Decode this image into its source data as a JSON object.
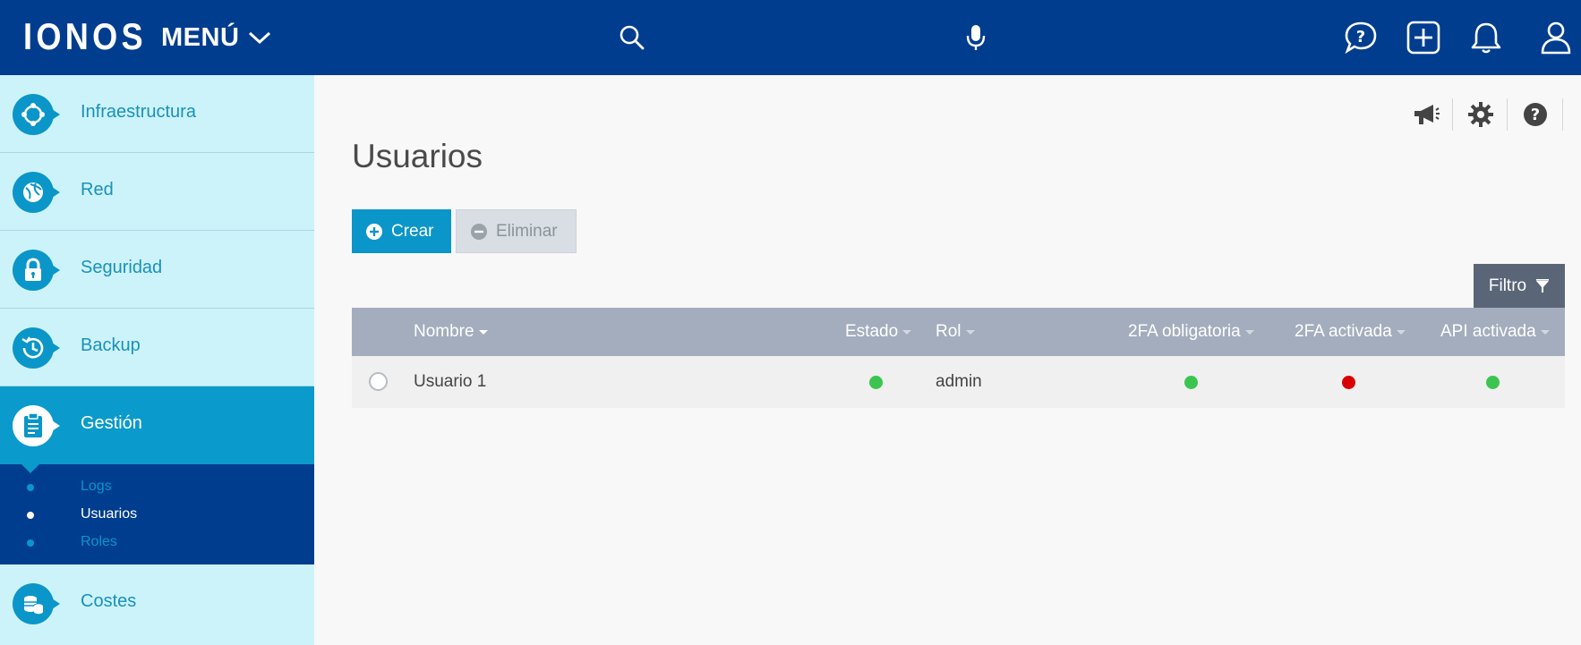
{
  "header": {
    "logo": "IONOS",
    "menu_label": "MENÚ",
    "icons": [
      "search-icon",
      "microphone-icon",
      "help-chat-icon",
      "add-icon",
      "bell-icon",
      "user-icon"
    ]
  },
  "sidebar": {
    "items": [
      {
        "label": "Infraestructura",
        "icon": "infrastructure-icon"
      },
      {
        "label": "Red",
        "icon": "network-globe-icon"
      },
      {
        "label": "Seguridad",
        "icon": "lock-icon"
      },
      {
        "label": "Backup",
        "icon": "backup-clock-icon"
      },
      {
        "label": "Gestión",
        "icon": "clipboard-icon"
      },
      {
        "label": "Costes",
        "icon": "coins-icon"
      }
    ],
    "submenu": [
      {
        "label": "Logs"
      },
      {
        "label": "Usuarios"
      },
      {
        "label": "Roles"
      }
    ]
  },
  "main": {
    "title": "Usuarios",
    "create_label": "Crear",
    "delete_label": "Eliminar",
    "filter_label": "Filtro",
    "utility_icons": [
      "megaphone-icon",
      "gear-icon",
      "question-icon"
    ],
    "table": {
      "columns": [
        "Nombre",
        "Estado",
        "Rol",
        "2FA obligatoria",
        "2FA activada",
        "API activada"
      ],
      "rows": [
        {
          "nombre": "Usuario 1",
          "estado": "green",
          "rol": "admin",
          "twofa_obligatoria": "green",
          "twofa_activada": "red",
          "api_activada": "green"
        }
      ]
    }
  },
  "colors": {
    "topbar": "#003d8f",
    "accent": "#0a96c8",
    "sidebar_bg": "#cdf3fa",
    "status_green": "#3bc550",
    "status_red": "#d90000"
  }
}
